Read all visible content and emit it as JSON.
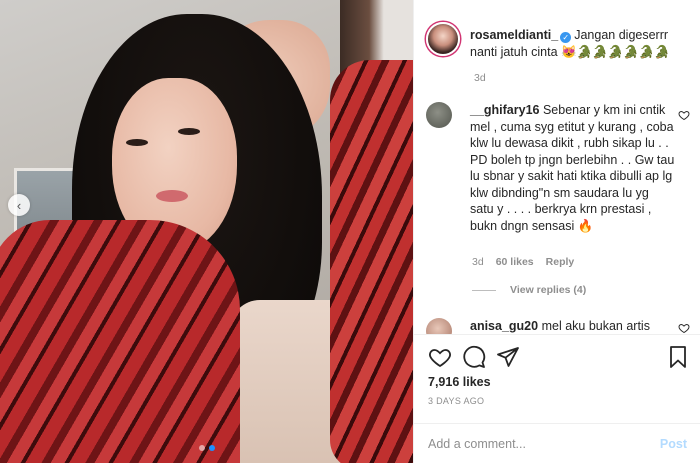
{
  "post": {
    "author": "rosameldianti_",
    "caption_line1": "Jangan digeserrr",
    "caption_line2": "nanti jatuh cinta",
    "caption_emoji": "😻🐊🐊🐊🐊🐊🐊",
    "caption_time": "3d"
  },
  "comments": [
    {
      "user": "__ghifary16",
      "text": "Sebenar y km ini cntik mel , cuma syg etitut y kurang , coba klw lu dewasa dikit , rubh sikap lu . . PD boleh tp jngn berlebihn . . Gw tau lu sbnar y sakit hati ktika dibulli ap lg klw dibnding\"n sm saudara lu yg satu y . . . . berkrya krn prestasi , bukn dngn sensasi",
      "emoji": "🔥",
      "time": "3d",
      "likes": "60 likes",
      "reply_label": "Reply",
      "view_replies": "View replies (4)"
    },
    {
      "user": "anisa_gu20",
      "text": "mel aku bukan artis"
    }
  ],
  "stats": {
    "likes": "7,916 likes",
    "date": "3 DAYS AGO"
  },
  "composer": {
    "placeholder": "Add a comment...",
    "post_label": "Post"
  },
  "icons": {
    "like": "heart-icon",
    "comment": "comment-icon",
    "share": "send-icon",
    "save": "bookmark-icon",
    "prev": "chevron-left-icon"
  },
  "colors": {
    "accent": "#3897f0",
    "post_disabled": "#b3dbff",
    "story_ring": "#d13472"
  },
  "carousel": {
    "prev_glyph": "‹",
    "count": 2,
    "active_index": 1
  }
}
